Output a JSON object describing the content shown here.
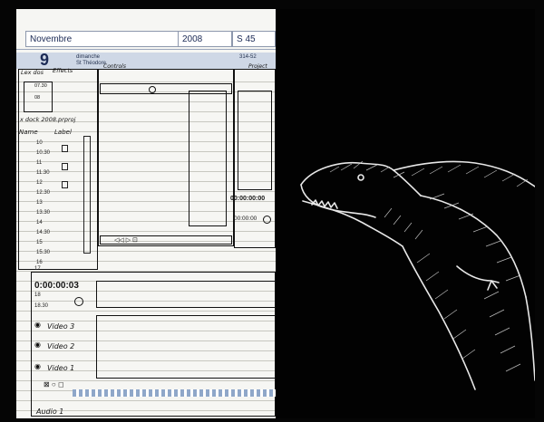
{
  "planner": {
    "month": "Novembre",
    "year": "2008",
    "week": "S 45",
    "day_number": "9",
    "day_caption": "dimanche",
    "day_caption2": "St Théodore",
    "corner_code": "314-52"
  },
  "sketch": {
    "panel_tabs": [
      "Lex dos",
      "Effects",
      "Controls",
      "Project"
    ],
    "time_top": [
      "07.30",
      "08"
    ],
    "project_label": "x dock 2008.prproj",
    "col_name": "Name",
    "col_label": "Label",
    "timecode_main": "0:00:00:03",
    "timecode_small": "00:00:00",
    "timecode_panel": "00:00:00:00",
    "tracks": [
      "Video 3",
      "Video 2",
      "Video 1",
      "Audio 1"
    ],
    "times": [
      "10",
      "10.30",
      "11",
      "11.30",
      "12",
      "12.30",
      "13",
      "13.30",
      "14",
      "14.30",
      "15",
      "15.30",
      "16",
      "17",
      "18",
      "18.30"
    ]
  }
}
